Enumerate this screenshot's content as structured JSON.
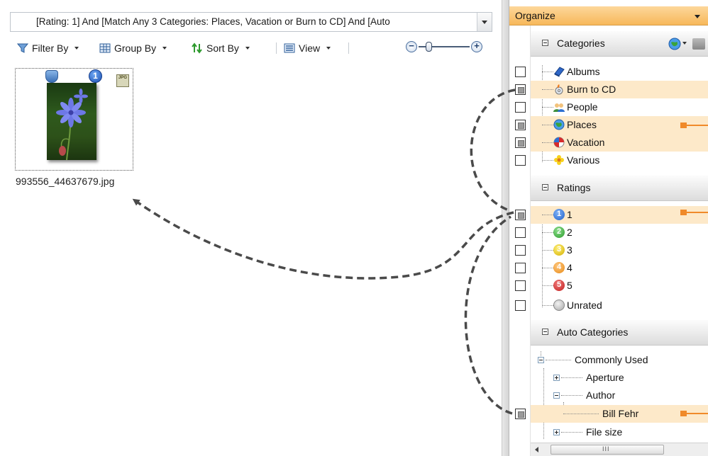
{
  "browser": {
    "filter_breadcrumb": "[Rating: 1] And [Match Any 3 Categories: Places, Vacation or Burn to CD] And [Auto",
    "toolbar": {
      "filter_by": "Filter By",
      "group_by": "Group By",
      "sort_by": "Sort By",
      "view": "View"
    },
    "thumbnail": {
      "filename": "993556_44637679.jpg",
      "rating": "1",
      "format_badge": "JPG"
    }
  },
  "organize": {
    "title": "Organize",
    "categories": {
      "title": "Categories",
      "items": [
        {
          "label": "Albums",
          "icon": "albums-book-icon",
          "checked": "none"
        },
        {
          "label": "Burn to CD",
          "icon": "burn-cd-icon",
          "checked": "mixed"
        },
        {
          "label": "People",
          "icon": "people-icon",
          "checked": "none"
        },
        {
          "label": "Places",
          "icon": "globe-icon",
          "checked": "mixed"
        },
        {
          "label": "Vacation",
          "icon": "beach-ball-icon",
          "checked": "mixed"
        },
        {
          "label": "Various",
          "icon": "flower-icon",
          "checked": "none"
        }
      ]
    },
    "ratings": {
      "title": "Ratings",
      "items": [
        {
          "label": "1",
          "color": "#1f5fc9",
          "checked": "mixed"
        },
        {
          "label": "2",
          "color": "#2b9a2b",
          "checked": "none"
        },
        {
          "label": "3",
          "color": "#d4b000",
          "checked": "none"
        },
        {
          "label": "4",
          "color": "#e88a16",
          "checked": "none"
        },
        {
          "label": "5",
          "color": "#c21e1e",
          "checked": "none"
        },
        {
          "label": "Unrated",
          "color": "#b9b9b9",
          "checked": "none"
        }
      ]
    },
    "auto_categories": {
      "title": "Auto Categories",
      "items": [
        {
          "label": "Commonly Used"
        },
        {
          "label": "Aperture"
        },
        {
          "label": "Author"
        },
        {
          "label": "Bill Fehr",
          "checked": "mixed"
        },
        {
          "label": "File size"
        }
      ]
    },
    "scroll_grip": "III"
  }
}
